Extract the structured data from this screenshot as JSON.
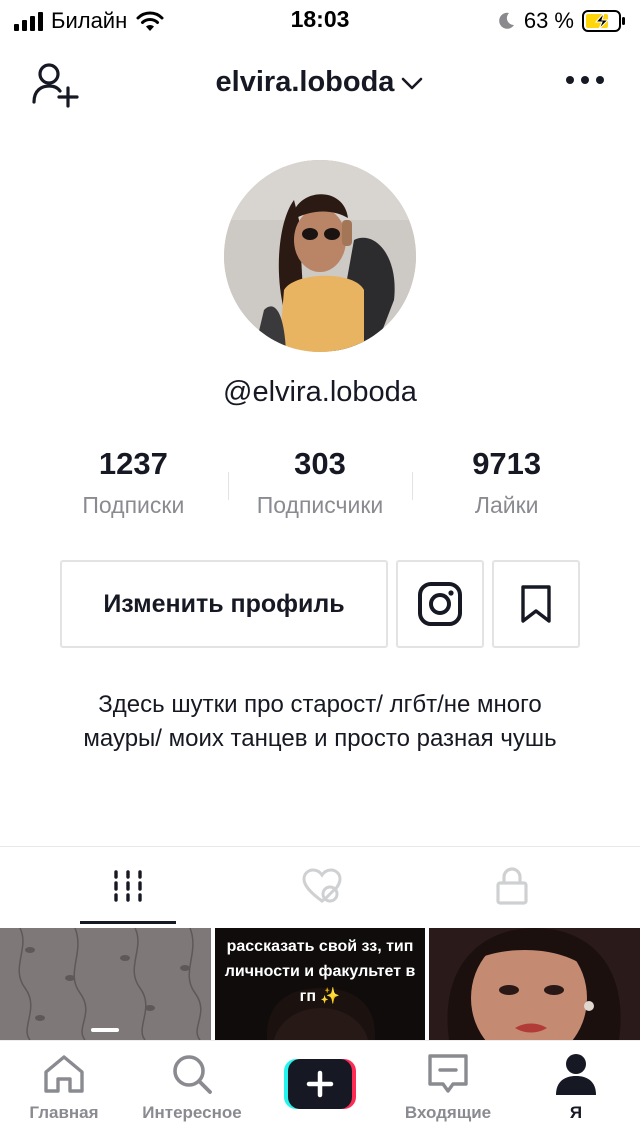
{
  "status_bar": {
    "carrier": "Билайн",
    "time": "18:03",
    "battery_percent": "63 %",
    "icons": [
      "signal-icon",
      "wifi-icon",
      "moon-icon",
      "battery-charging-icon"
    ]
  },
  "header": {
    "username": "elvira.loboda",
    "icons": [
      "add-user-icon",
      "chevron-down-icon",
      "more-icon"
    ]
  },
  "profile": {
    "handle": "@elvira.loboda",
    "stats": [
      {
        "value": "1237",
        "label": "Подписки"
      },
      {
        "value": "303",
        "label": "Подписчики"
      },
      {
        "value": "9713",
        "label": "Лайки"
      }
    ],
    "edit_button": "Изменить профиль",
    "bio": "Здесь шутки про старост/ лгбт/не много мауры/ моих танцев и просто разная чушь"
  },
  "tabs": {
    "active": "videos",
    "icons": [
      "grid-icon",
      "liked-hidden-icon",
      "lock-icon"
    ]
  },
  "videos": [
    {
      "caption": ""
    },
    {
      "caption": "рассказать свой зз, тип личности и факультет в гп ✨"
    },
    {
      "caption": ""
    }
  ],
  "bottom_nav": {
    "items": [
      {
        "label": "Главная",
        "icon": "home-icon"
      },
      {
        "label": "Интересное",
        "icon": "search-icon"
      },
      {
        "label": "Входящие",
        "icon": "inbox-icon"
      },
      {
        "label": "Я",
        "icon": "profile-icon"
      }
    ],
    "active": "Я"
  },
  "colors": {
    "text": "#161823",
    "muted": "#8a8b91",
    "border": "#e3e3e4",
    "tiktok_cyan": "#25f4ee",
    "tiktok_red": "#fe2c55",
    "battery_yellow": "#ffd60a"
  }
}
